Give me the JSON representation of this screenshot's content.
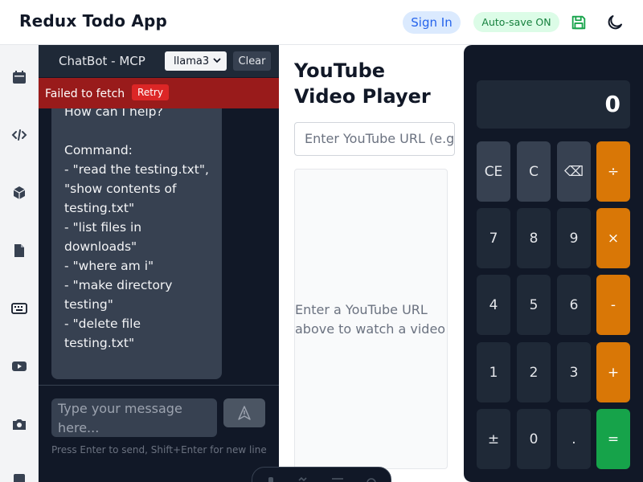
{
  "header": {
    "title": "Redux Todo App",
    "sign_in": "Sign In",
    "autosave": "Auto-save ON",
    "icons": [
      "save-icon",
      "moon-icon"
    ]
  },
  "sidebar": {
    "icons": [
      "calendar-icon",
      "code-icon",
      "cube-icon",
      "file-icon",
      "keyboard-icon",
      "youtube-icon",
      "camera-icon",
      "notes-icon"
    ]
  },
  "chat": {
    "title": "ChatBot - MCP",
    "model": "llama3",
    "clear": "Clear",
    "error": "Failed to fetch",
    "retry": "Retry",
    "message": "How can I help?\n\nCommand:\n- \"read the testing.txt\", \"show contents of testing.txt\"\n- \"list files in downloads\"\n- \"where am i\"\n- \"make directory testing\"\n- \"delete file testing.txt\"",
    "input_placeholder": "Type your message here...",
    "hint": "Press Enter to send, Shift+Enter for new line"
  },
  "video": {
    "title": "YouTube\nVideo Player",
    "url_placeholder": "Enter YouTube URL (e.g.",
    "empty_text": "Enter a YouTube URL above to watch a video"
  },
  "calculator": {
    "display": "0",
    "rows": [
      [
        "CE",
        "C",
        "⌫",
        "÷"
      ],
      [
        "7",
        "8",
        "9",
        "×"
      ],
      [
        "4",
        "5",
        "6",
        "-"
      ],
      [
        "1",
        "2",
        "3",
        "+"
      ],
      [
        "±",
        "0",
        ".",
        "="
      ]
    ]
  },
  "colors": {
    "accent_blue": "#2563eb",
    "success_green": "#15803d",
    "operator_orange": "#d97706",
    "equals_green": "#16a34a",
    "error_red": "#991b1b",
    "panel_dark": "#111827"
  }
}
